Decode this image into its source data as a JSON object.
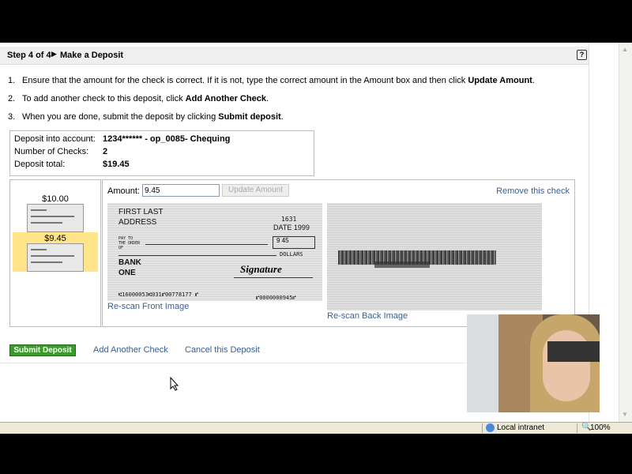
{
  "header": {
    "step": "Step 4 of 4",
    "title": "Make a Deposit",
    "help_icon": "?"
  },
  "instructions": [
    {
      "num": "1.",
      "pre": "Ensure that the amount for the check is correct. If it is not, type the correct amount in the Amount box and then click ",
      "bold": "Update Amount",
      "post": "."
    },
    {
      "num": "2.",
      "pre": "To add another check to this deposit, click ",
      "bold": "Add Another Check",
      "post": "."
    },
    {
      "num": "3.",
      "pre": "When you are done, submit the deposit by clicking ",
      "bold": "Submit deposit",
      "post": "."
    }
  ],
  "summary": {
    "account_label": "Deposit into account:",
    "account_value": "1234****** - op_0085- Chequing",
    "count_label": "Number of Checks:",
    "count_value": "2",
    "total_label": "Deposit total:",
    "total_value": "$19.45"
  },
  "checks": [
    {
      "amount": "$10.00",
      "selected": false
    },
    {
      "amount": "$9.45",
      "selected": true
    }
  ],
  "detail": {
    "amount_label": "Amount:",
    "amount_value": "9.45",
    "update_button": "Update Amount",
    "remove_link": "Remove this check",
    "front_check": {
      "name": "FIRST LAST",
      "address": "ADDRESS",
      "number": "1631",
      "date": "DATE 1999",
      "pay_to": "PAY TO THE ORDER OF",
      "bank1": "BANK",
      "bank2": "ONE",
      "signature": "Signature",
      "dollars": "DOLLARS",
      "micr": "⑆16000053⑆031⑈00778177 ⑈",
      "micr_amount": "⑈0000000945⑈",
      "box_amount": "9 45"
    },
    "rescan_front": "Re-scan Front Image",
    "rescan_back": "Re-scan Back Image"
  },
  "actions": {
    "submit": "Submit Deposit",
    "add": "Add Another Check",
    "cancel": "Cancel this Deposit"
  },
  "status_bar": {
    "zone": "Local intranet",
    "zoom": "100%"
  },
  "colors": {
    "submit_green": "#3a9a2a",
    "link_blue": "#3a5f8f",
    "selected_highlight": "#ffe48a"
  }
}
